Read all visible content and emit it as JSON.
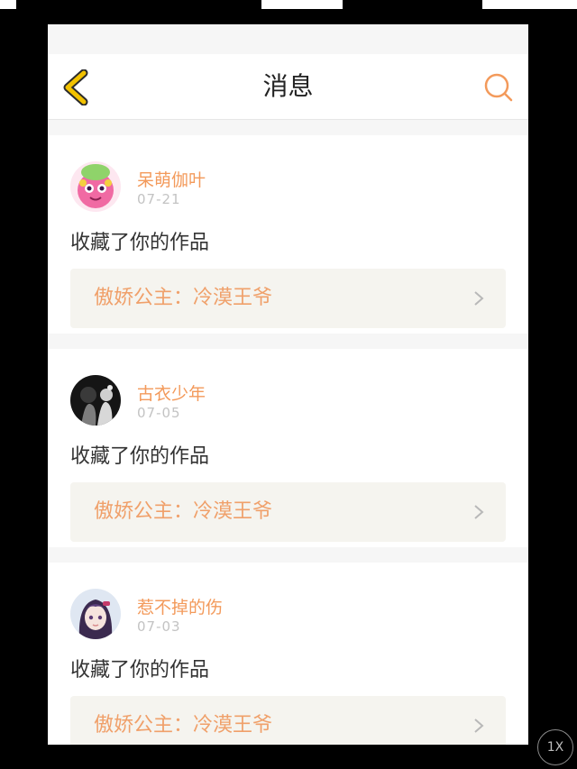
{
  "header": {
    "title": "消息"
  },
  "messages": [
    {
      "user": "呆萌伽叶",
      "date": "07-21",
      "action": "收藏了你的作品",
      "work": "傲娇公主：冷漠王爷"
    },
    {
      "user": "古衣少年",
      "date": "07-05",
      "action": "收藏了你的作品",
      "work": "傲娇公主：冷漠王爷"
    },
    {
      "user": "惹不掉的伤",
      "date": "07-03",
      "action": "收藏了你的作品",
      "work": "傲娇公主：冷漠王爷"
    }
  ],
  "zoom": "1X",
  "colors": {
    "accent": "#f39a5b",
    "back_arrow": "#f2c200",
    "link_bg": "#f5f4ef"
  }
}
